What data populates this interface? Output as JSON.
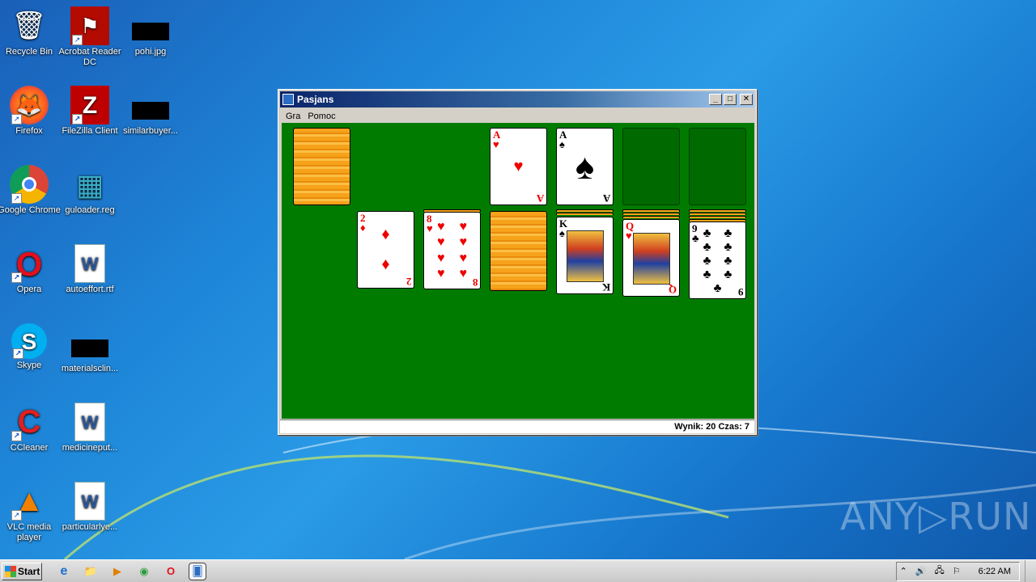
{
  "desktop": {
    "icons": [
      {
        "label": "Recycle Bin",
        "glyph": "🗑"
      },
      {
        "label": "Acrobat Reader DC",
        "glyph": "⚑"
      },
      {
        "label": "pohi.jpg",
        "glyph": ""
      },
      {
        "label": "Firefox",
        "glyph": "🦊"
      },
      {
        "label": "FileZilla Client",
        "glyph": "Z"
      },
      {
        "label": "similarbuyer...",
        "glyph": ""
      },
      {
        "label": "Google Chrome",
        "glyph": "◉"
      },
      {
        "label": "guloader.reg",
        "glyph": "▦"
      },
      {
        "label": "Opera",
        "glyph": "O"
      },
      {
        "label": "autoeffort.rtf",
        "glyph": "W"
      },
      {
        "label": "Skype",
        "glyph": "S"
      },
      {
        "label": "materialsclin...",
        "glyph": ""
      },
      {
        "label": "CCleaner",
        "glyph": "C"
      },
      {
        "label": "medicineput...",
        "glyph": "W"
      },
      {
        "label": "VLC media player",
        "glyph": "▲"
      },
      {
        "label": "particularlye...",
        "glyph": "W"
      }
    ]
  },
  "window": {
    "title": "Pasjans",
    "buttons": {
      "minimize": "_",
      "maximize": "□",
      "close": "✕"
    },
    "menu": [
      "Gra",
      "Pomoc"
    ],
    "status": "Wynik: 20 Czas: 7"
  },
  "cards": {
    "foundation1": {
      "rank": "A",
      "suit": "♥",
      "color": "red"
    },
    "foundation2": {
      "rank": "A",
      "suit": "♠",
      "color": "black"
    },
    "tab1": {
      "rank": "2",
      "suit": "♦",
      "color": "red"
    },
    "tab2": {
      "rank": "8",
      "suit": "♥",
      "color": "red"
    },
    "tab4": {
      "rank": "K",
      "suit": "♠",
      "color": "black"
    },
    "tab5": {
      "rank": "Q",
      "suit": "♥",
      "color": "red"
    },
    "tab6": {
      "rank": "9",
      "suit": "♣",
      "color": "black"
    }
  },
  "taskbar": {
    "start_label": "Start",
    "pins": [
      "e",
      "📁",
      "▶",
      "◉",
      "O",
      "🂠"
    ],
    "tray_icons": [
      "⌃",
      "🔊",
      "🖧",
      "⚐"
    ],
    "clock": "6:22 AM"
  },
  "watermark": "ANY▷RUN",
  "colors": {
    "table_green": "#007b00",
    "title_blue": "#0a246a"
  }
}
